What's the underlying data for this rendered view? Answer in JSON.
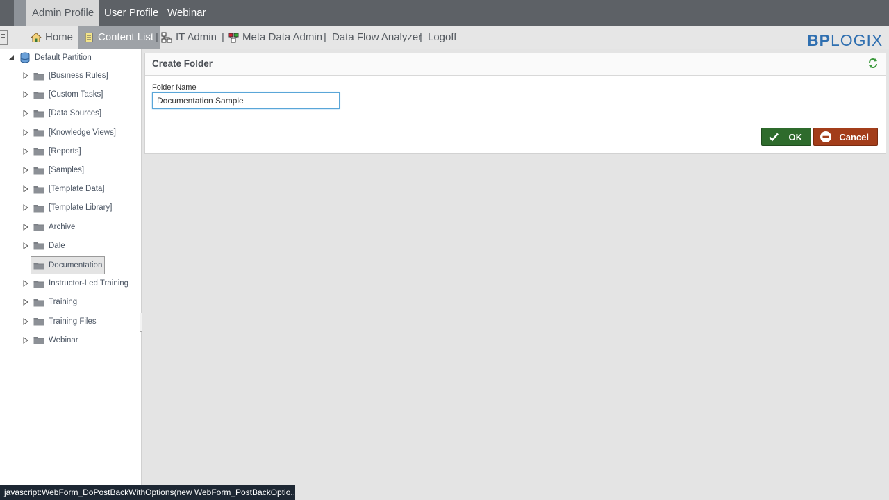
{
  "profile_tabs": [
    {
      "label": "Admin Profile",
      "active": true
    },
    {
      "label": "User Profile",
      "active": false
    },
    {
      "label": "Webinar",
      "active": false
    }
  ],
  "nav": {
    "home": "Home",
    "content_list": "Content List",
    "it_admin": "IT Admin",
    "meta_data_admin": "Meta Data Admin",
    "data_flow_analyzer": "Data Flow Analyzer",
    "logoff": "Logoff",
    "separator": "|"
  },
  "logo": {
    "bp": "BP",
    "rest": "LOGIX"
  },
  "tree": {
    "root": "Default Partition",
    "items": [
      {
        "label": "[Business Rules]",
        "expandable": true
      },
      {
        "label": "[Custom Tasks]",
        "expandable": true
      },
      {
        "label": "[Data Sources]",
        "expandable": true
      },
      {
        "label": "[Knowledge Views]",
        "expandable": true
      },
      {
        "label": "[Reports]",
        "expandable": true
      },
      {
        "label": "[Samples]",
        "expandable": true
      },
      {
        "label": "[Template Data]",
        "expandable": true
      },
      {
        "label": "[Template Library]",
        "expandable": true
      },
      {
        "label": "Archive",
        "expandable": true
      },
      {
        "label": "Dale",
        "expandable": true
      },
      {
        "label": "Documentation",
        "expandable": false,
        "selected": true
      },
      {
        "label": "Instructor-Led Training",
        "expandable": true
      },
      {
        "label": "Training",
        "expandable": true
      },
      {
        "label": "Training Files",
        "expandable": true
      },
      {
        "label": "Webinar",
        "expandable": true
      }
    ]
  },
  "form": {
    "title": "Create Folder",
    "field_label": "Folder Name",
    "field_value": "Documentation Sample",
    "ok_label": "OK",
    "cancel_label": "Cancel"
  },
  "status_bar": "javascript:WebForm_DoPostBackWithOptions(new WebForm_PostBackOptio...",
  "colors": {
    "topbar": "#5d6166",
    "navbar": "#e6e6e6",
    "ok_button": "#2e6b2c",
    "cancel_button": "#a33d1a",
    "logo": "#2f6fb0"
  },
  "icons": [
    "home-icon",
    "content-list-icon",
    "it-admin-icon",
    "meta-data-icon",
    "database-icon",
    "folder-icon",
    "expand-arrow-icon",
    "refresh-icon",
    "checkmark-icon",
    "minus-circle-icon"
  ]
}
